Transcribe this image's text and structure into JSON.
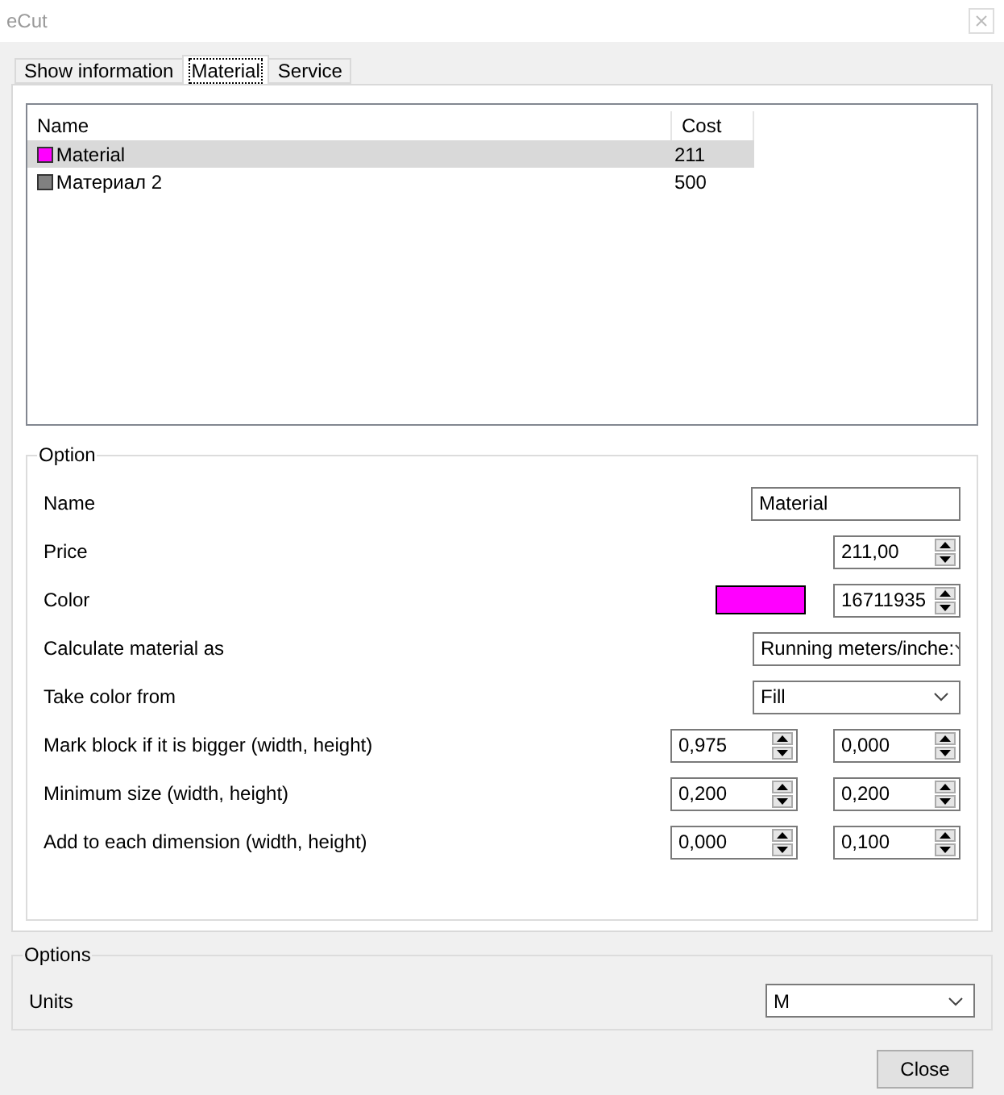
{
  "window": {
    "title": "eCut"
  },
  "tabs": [
    {
      "label": "Show information",
      "selected": false
    },
    {
      "label": "Material",
      "selected": true
    },
    {
      "label": "Service",
      "selected": false
    }
  ],
  "materials": {
    "columns": [
      "Name",
      "Cost"
    ],
    "rows": [
      {
        "name": "Material",
        "cost": "211",
        "color": "#ff00ff",
        "selected": true
      },
      {
        "name": "Материал 2",
        "cost": "500",
        "color": "#808080",
        "selected": false
      }
    ]
  },
  "option": {
    "title": "Option",
    "rows": [
      {
        "kind": "text",
        "label": "Name",
        "values": [
          "Material"
        ]
      },
      {
        "kind": "spin",
        "label": "Price",
        "values": [
          "211,00"
        ]
      },
      {
        "kind": "color",
        "label": "Color",
        "color": "#ff00ff",
        "values": [
          "16711935"
        ]
      },
      {
        "kind": "combo",
        "label": "Calculate material as",
        "values": [
          "Running meters/inche:"
        ]
      },
      {
        "kind": "combo",
        "label": "Take color from",
        "values": [
          "Fill"
        ]
      },
      {
        "kind": "spin2",
        "label": "Mark block if it is bigger (width, height)",
        "values": [
          "0,975",
          "0,000"
        ]
      },
      {
        "kind": "spin2",
        "label": "Minimum size (width, height)",
        "values": [
          "0,200",
          "0,200"
        ]
      },
      {
        "kind": "spin2",
        "label": "Add to each dimension (width, height)",
        "values": [
          "0,000",
          "0,100"
        ]
      }
    ]
  },
  "options": {
    "title": "Options",
    "units_label": "Units",
    "units": "M"
  },
  "buttons": [
    "Close"
  ]
}
